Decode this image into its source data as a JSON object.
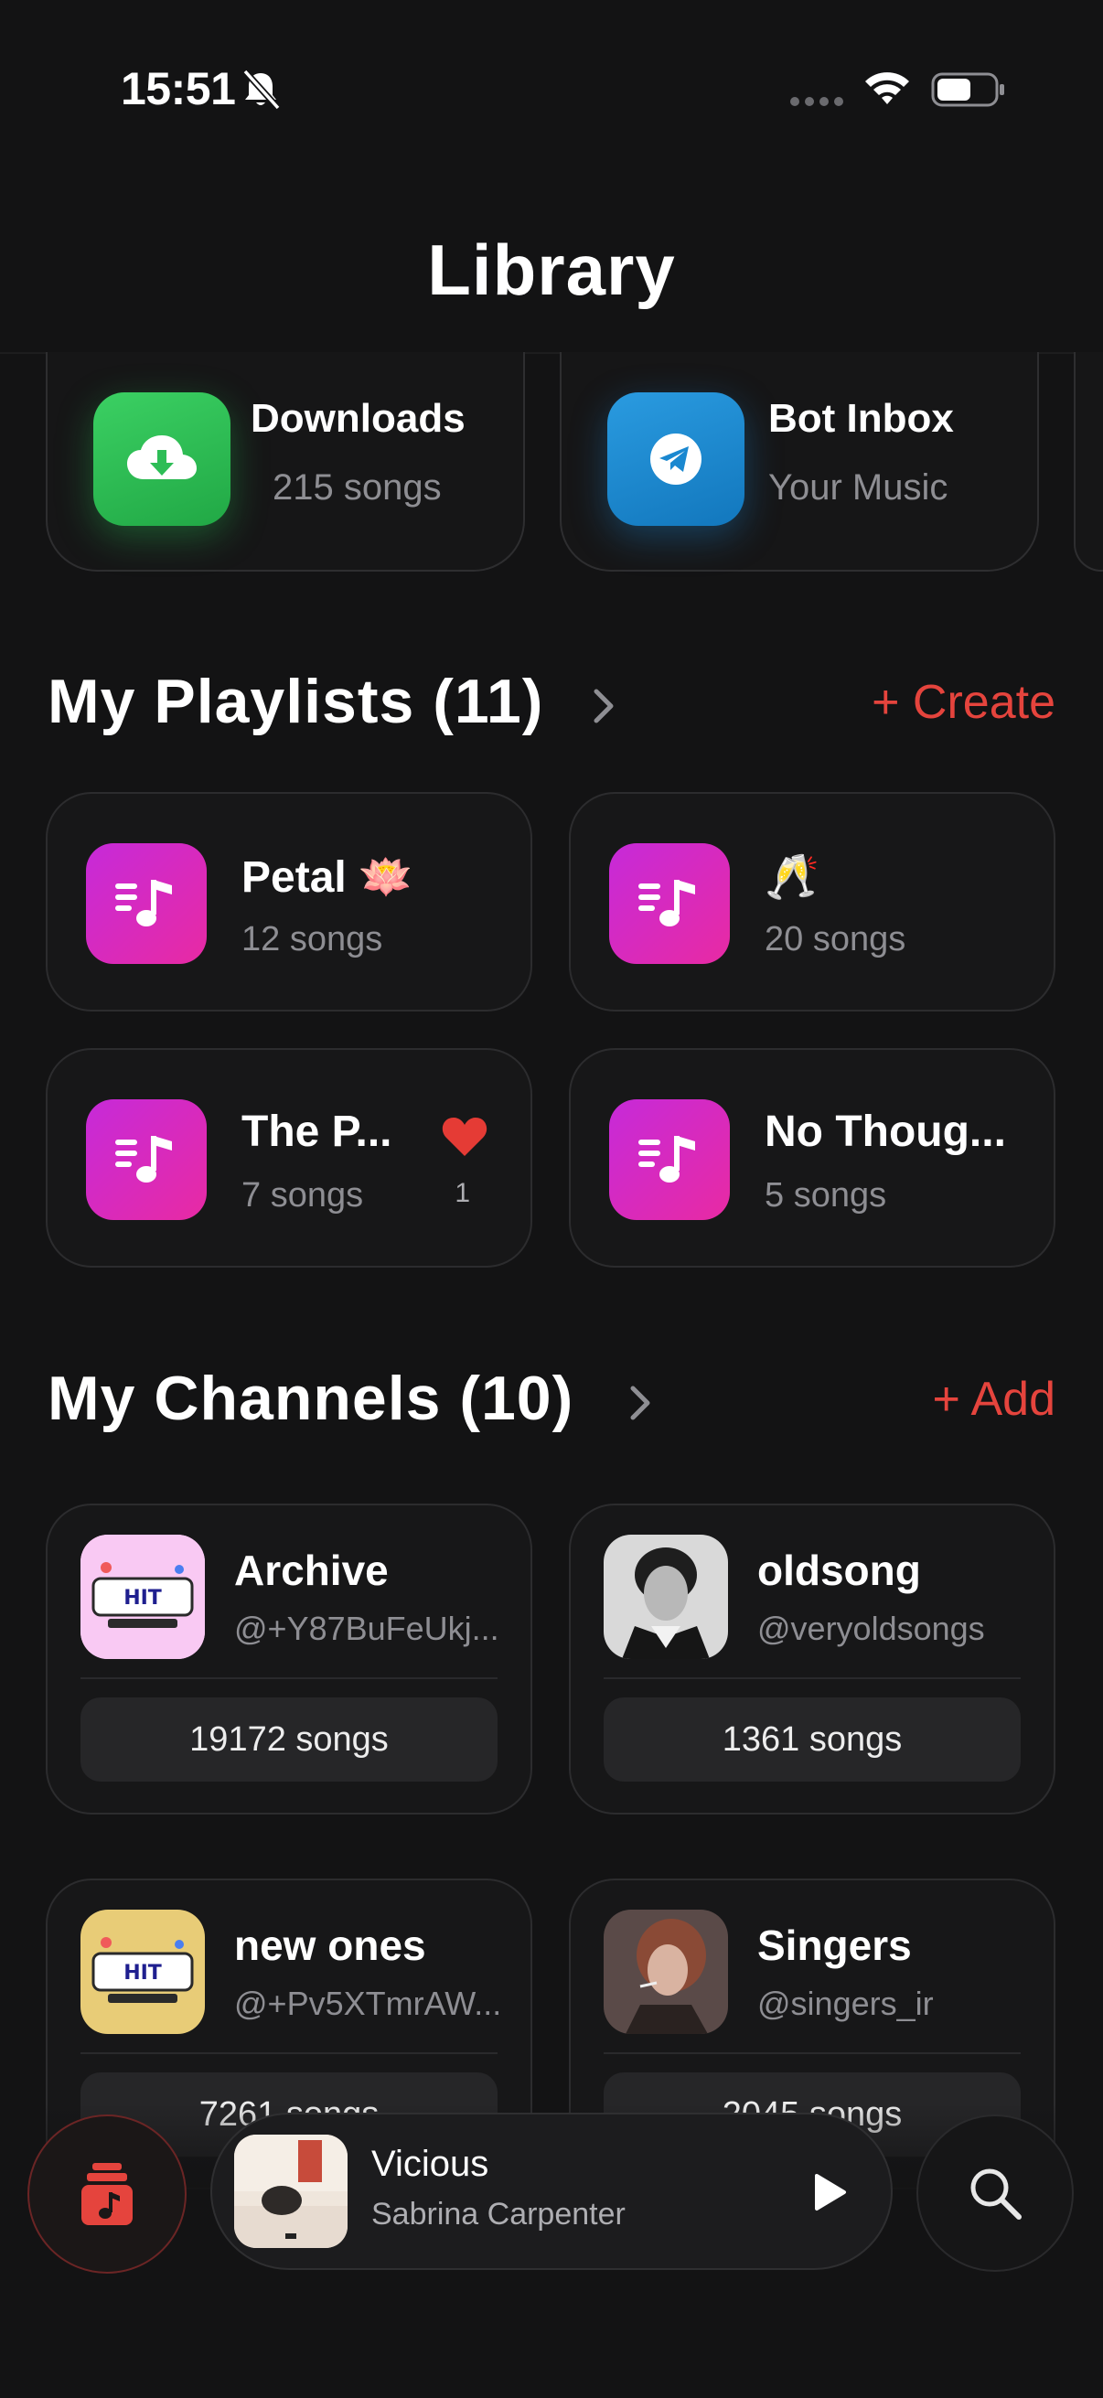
{
  "status_bar": {
    "time": "15:51"
  },
  "header": {
    "title": "Library"
  },
  "quick_access": [
    {
      "title": "Downloads",
      "subtitle": "215 songs",
      "icon": "cloud-download-icon",
      "color": "#2dbd56"
    },
    {
      "title": "Bot Inbox",
      "subtitle": "Your Music",
      "icon": "telegram-icon",
      "color": "#1a88d0"
    }
  ],
  "playlists": {
    "title": "My Playlists (11)",
    "action": "+ Create",
    "items": [
      {
        "name": "Petal 🪷",
        "count": "12 songs"
      },
      {
        "name": "🥂",
        "count": "20 songs"
      },
      {
        "name": "The P...",
        "count": "7 songs",
        "likes": "1"
      },
      {
        "name": "No Thoug...",
        "count": "5 songs"
      }
    ]
  },
  "channels": {
    "title": "My Channels (10)",
    "action": "+ Add",
    "items": [
      {
        "name": "Archive",
        "handle": "@+Y87BuFeUkj...",
        "count": "19172 songs"
      },
      {
        "name": "oldsong",
        "handle": "@veryoldsongs",
        "count": "1361 songs"
      },
      {
        "name": "new ones",
        "handle": "@+Pv5XTmrAW...",
        "count": "7261 songs"
      },
      {
        "name": "Singers",
        "handle": "@singers_ir",
        "count": "2045 songs"
      }
    ]
  },
  "player": {
    "title": "Vicious",
    "artist": "Sabrina Carpenter"
  },
  "colors": {
    "accent": "#e5443d",
    "playlist_gradient_start": "#c62ad9",
    "playlist_gradient_end": "#e82aa3",
    "background": "#131314"
  }
}
